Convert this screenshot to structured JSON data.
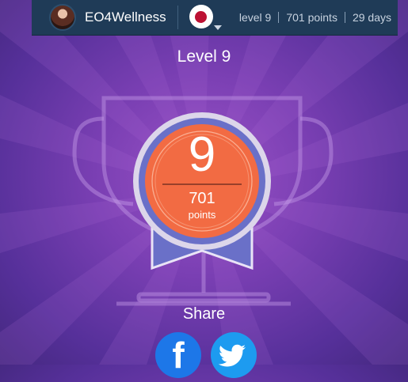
{
  "header": {
    "username": "EO4Wellness",
    "language_flag": "japan-flag-icon",
    "level_stat": "level 9",
    "points_stat": "701 points",
    "days_stat": "29 days"
  },
  "achievement": {
    "title": "Level 9",
    "level_number": "9",
    "points_value": "701",
    "points_label": "points"
  },
  "share": {
    "title": "Share",
    "buttons": [
      "facebook-icon",
      "twitter-icon"
    ]
  },
  "colors": {
    "top_bar": "#1f3b57",
    "background": "#7a3fb3",
    "medal_orange": "#f26b43",
    "ribbon": "#6a70c8",
    "facebook": "#1d77e8",
    "twitter": "#1d9bf0"
  }
}
